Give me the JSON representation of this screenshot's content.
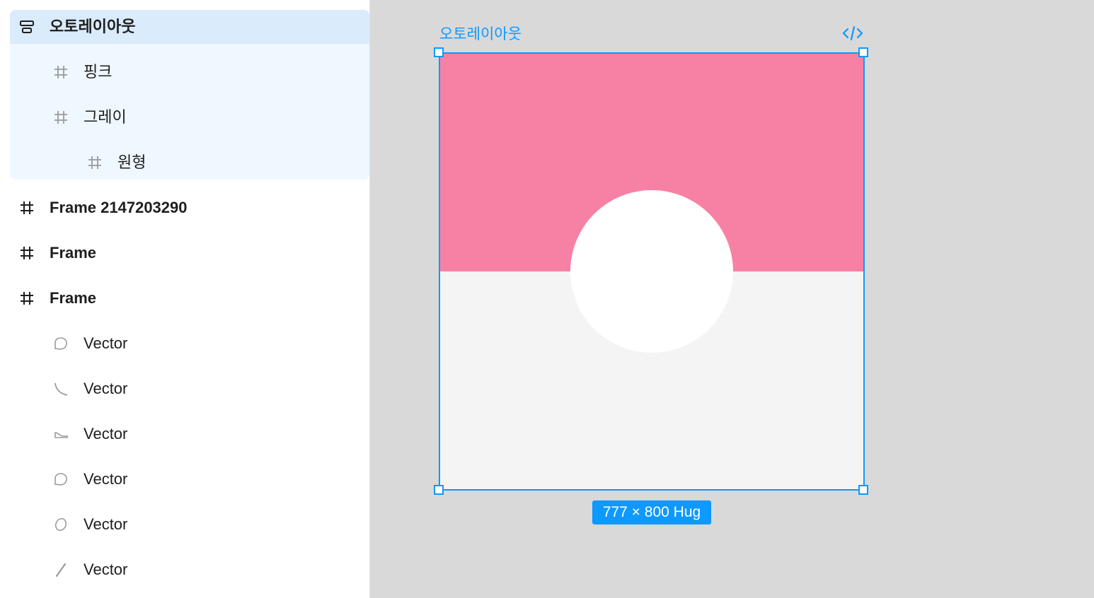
{
  "layers": {
    "items": [
      {
        "label": "오토레이아웃",
        "icon": "auto-layout-icon"
      },
      {
        "label": "핑크",
        "icon": "frame-icon"
      },
      {
        "label": "그레이",
        "icon": "frame-icon"
      },
      {
        "label": "원형",
        "icon": "frame-icon"
      },
      {
        "label": "Frame 2147203290",
        "icon": "frame-icon"
      },
      {
        "label": "Frame",
        "icon": "frame-icon"
      },
      {
        "label": "Frame",
        "icon": "frame-icon"
      },
      {
        "label": "Vector",
        "icon": "vector-icon"
      },
      {
        "label": "Vector",
        "icon": "vector-icon"
      },
      {
        "label": "Vector",
        "icon": "vector-icon"
      },
      {
        "label": "Vector",
        "icon": "vector-icon"
      },
      {
        "label": "Vector",
        "icon": "vector-icon"
      },
      {
        "label": "Vector",
        "icon": "vector-icon"
      }
    ]
  },
  "canvas": {
    "frame_title": "오토레이아웃",
    "code_icon": "code-icon",
    "size_label": "777 × 800 Hug"
  },
  "colors": {
    "accent": "#0d99ff",
    "pink": "#f781a5",
    "gray": "#f4f4f4",
    "circle": "#ffffff",
    "selection_bg": "#eff7ff",
    "selection_head_bg": "#daebfb"
  }
}
